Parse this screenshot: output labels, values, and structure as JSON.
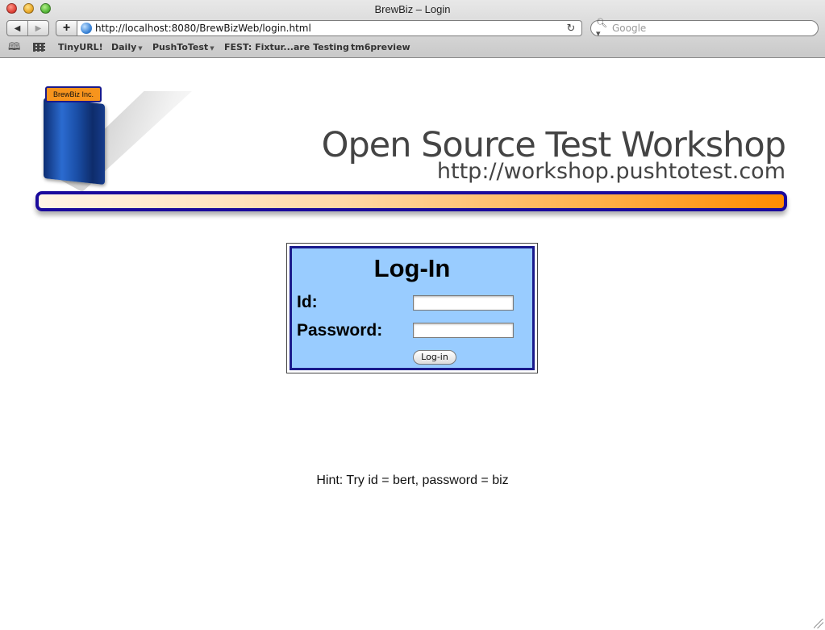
{
  "window": {
    "title": "BrewBiz – Login"
  },
  "toolbar": {
    "back_icon": "back-arrow-icon",
    "forward_icon": "forward-arrow-icon",
    "add_bookmark_label": "+",
    "url": "http://localhost:8080/BrewBizWeb/login.html",
    "reload_icon": "reload-icon",
    "search_placeholder": "Google"
  },
  "bookmarks": {
    "items": [
      {
        "label": "TinyURL!",
        "menu": false
      },
      {
        "label": "Daily",
        "menu": true
      },
      {
        "label": "PushToTest",
        "menu": true
      },
      {
        "label": "FEST: Fixtur...are Testing",
        "menu": false
      },
      {
        "label": "tm6preview",
        "menu": false
      }
    ]
  },
  "banner": {
    "logo_label": "BrewBiz Inc.",
    "title": "Open Source Test Workshop",
    "url": "http://workshop.pushtotest.com"
  },
  "login": {
    "heading": "Log-In",
    "id_label": "Id:",
    "password_label": "Password:",
    "id_value": "",
    "password_value": "",
    "button_label": "Log-in"
  },
  "hint": "Hint: Try id = bert, password = biz",
  "colors": {
    "login_background": "#99ccff",
    "login_border": "#1a1a8c",
    "banner_bar_start": "#fff4e6",
    "banner_bar_end": "#ff8c00",
    "logo_label_bg": "#f7941d"
  }
}
